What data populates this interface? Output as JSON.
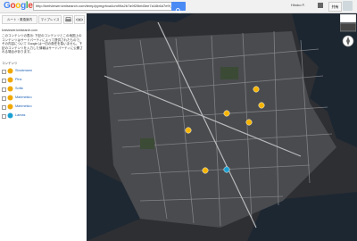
{
  "header": {
    "logo_text": "Google",
    "url": "http://kmlviewer.kmlsearch.com/temp/pymgrhxa4cm99a2b7a9f20bfd3ee7a16b6d7e9f_kml",
    "user_label": "Hiroko F.",
    "share_label": "共有"
  },
  "toolbar": {
    "btn1": "ルート・乗換案内",
    "btn2": "マイプレイス",
    "btn3": "印刷",
    "btn4": "リンク"
  },
  "panel": {
    "link": "kmlviewer.kmlsearch.com",
    "description": "このコンテンツの表示: 下記のコンテンツとこの地図上のコンテンツはサードパーティによって提供されたもので、その内容について Google は一切の責任を負いません。下記のコンテンツを入力した情報はサードパーティに公開される場合があります。",
    "contents_label": "コンテンツ",
    "categories": [
      {
        "label": "Stockmann",
        "pin_color": "#f0a800"
      },
      {
        "label": "Pins",
        "pin_color": "#f0a800"
      },
      {
        "label": "Sofia",
        "pin_color": "#f0a800"
      },
      {
        "label": "Marimekko",
        "pin_color": "#f0a800"
      },
      {
        "label": "Marimekko",
        "pin_color": "#f0a800"
      },
      {
        "label": "Lamas",
        "pin_color": "#1aa0d0"
      }
    ]
  },
  "map": {
    "view_label": "地図",
    "satellite_label": "航空写真"
  }
}
